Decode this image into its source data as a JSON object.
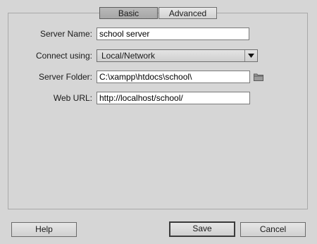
{
  "tabs": [
    {
      "label": "Basic",
      "active": true
    },
    {
      "label": "Advanced",
      "active": false
    }
  ],
  "form": {
    "server_name": {
      "label": "Server Name:",
      "value": "school server"
    },
    "connect_using": {
      "label": "Connect using:",
      "value": "Local/Network"
    },
    "server_folder": {
      "label": "Server Folder:",
      "value": "C:\\xampp\\htdocs\\school\\"
    },
    "web_url": {
      "label": "Web URL:",
      "value": "http://localhost/school/"
    }
  },
  "icons": {
    "folder": "folder-icon",
    "dropdown": "chevron-down-icon"
  },
  "buttons": {
    "help": "Help",
    "save": "Save",
    "cancel": "Cancel"
  }
}
